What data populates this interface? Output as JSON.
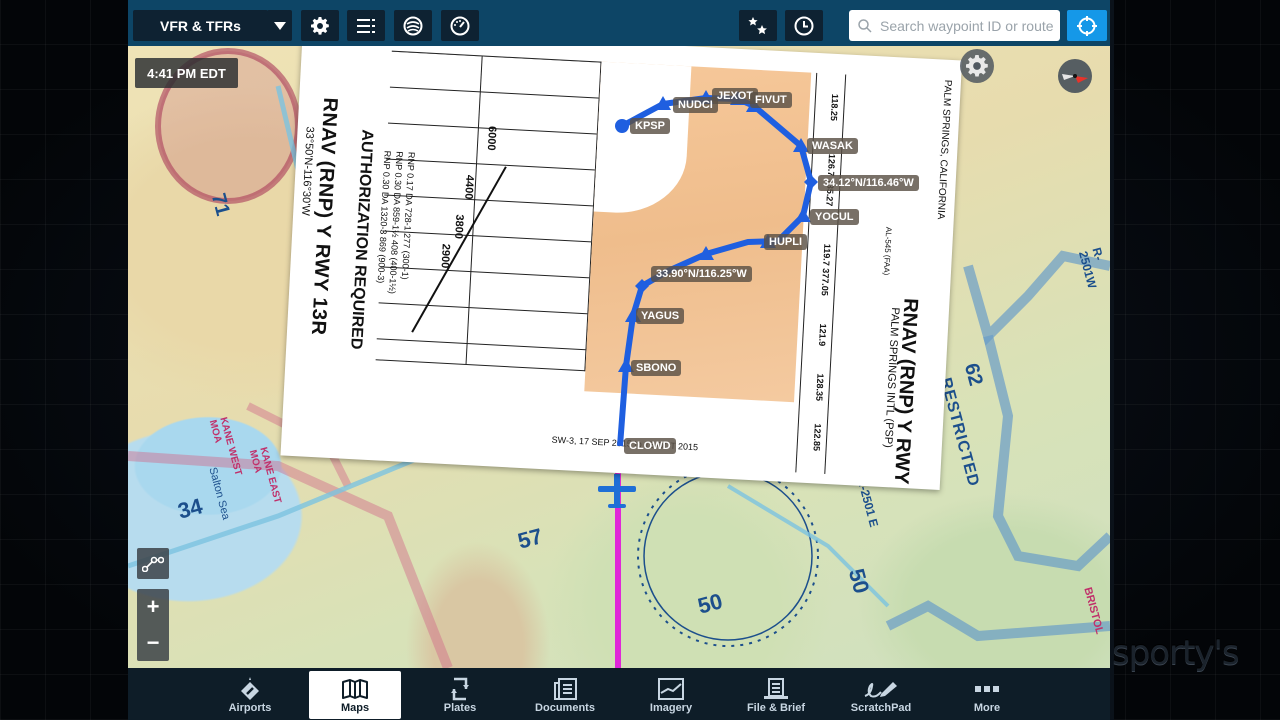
{
  "topbar": {
    "layer_selector": {
      "label": "VFR & TFRs",
      "icon": "caret-down-icon"
    },
    "buttons": [
      {
        "name": "settings",
        "icon": "gear-icon"
      },
      {
        "name": "layers-list",
        "icon": "list-icon"
      },
      {
        "name": "aircraft-profiles",
        "icon": "globe-icon"
      },
      {
        "name": "instruments",
        "icon": "gauge-icon"
      },
      {
        "name": "favorites",
        "icon": "stars-icon"
      },
      {
        "name": "recents",
        "icon": "clock-icon"
      }
    ],
    "search": {
      "placeholder": "Search waypoint ID or route",
      "value": ""
    },
    "locate_icon": "crosshair-icon"
  },
  "map": {
    "time": "4:41 PM EDT",
    "gear_icon": "gear-icon",
    "compass_icon": "compass-icon",
    "controls": {
      "route_icon": "route-edit-icon",
      "zoom_in": "+",
      "zoom_out": "−"
    },
    "chart_labels": {
      "restricted": "RESTRICTED",
      "r2501w": "R-2501W",
      "r2501e": "R-2501 E",
      "num_62": "62",
      "num_34": "34",
      "num_57": "57",
      "num_50a": "50",
      "num_50b": "50",
      "num_71": "71",
      "kane_west": "KANE WEST MOA",
      "kane_east": "KANE EAST MOA",
      "salton_sea": "Salton Sea",
      "bristol": "BRISTOL"
    },
    "route": {
      "color": "#1f5fe0",
      "active_leg_color": "#e026d8",
      "waypoints": [
        {
          "id": "KPSP"
        },
        {
          "id": "NUDCI"
        },
        {
          "id": "JEXOT"
        },
        {
          "id": "FIVUT"
        },
        {
          "id": "WASAK"
        },
        {
          "id": "34.12°N/116.46°W"
        },
        {
          "id": "YOCUL"
        },
        {
          "id": "HUPLI"
        },
        {
          "id": "33.90°N/116.25°W"
        },
        {
          "id": "YAGUS"
        },
        {
          "id": "SBONO"
        },
        {
          "id": "CLOWD"
        }
      ]
    },
    "approach_plate": {
      "title": "RNAV (RNP) Y RWY 13R",
      "airport": "PALM SPRINGS INTL (PSP)",
      "location": "PALM SPRINGS, CALIFORNIA",
      "authorization": "AUTHORIZATION REQUIRED",
      "coords": "33°50'N-116°30'W",
      "effective": "SW-3, 17 SEP 2015 to 15 OCT 2015",
      "al_number": "AL-545 (FAA)",
      "freqs": {
        "atis": "118.25",
        "socal_app": "126.7 135.27",
        "tower": "119.7 377.05",
        "gnd_con": "121.9",
        "clnc_del": "128.35",
        "unicom": "122.85"
      },
      "minimums": [
        "RNP 0.17 DA 728-1 277 (300-1)",
        "RNP 0.30 DA 859-1½ 408 (400-1½)",
        "RNP 0.30 DA 1320-3 869 (900-3)"
      ],
      "profile_alts": [
        "6000",
        "4400",
        "3800",
        "2900"
      ]
    }
  },
  "bottombar": {
    "tabs": [
      {
        "label": "Airports",
        "icon": "airport-icon",
        "active": false
      },
      {
        "label": "Maps",
        "icon": "map-icon",
        "active": true
      },
      {
        "label": "Plates",
        "icon": "plates-icon",
        "active": false
      },
      {
        "label": "Documents",
        "icon": "documents-icon",
        "active": false
      },
      {
        "label": "Imagery",
        "icon": "imagery-icon",
        "active": false
      },
      {
        "label": "File & Brief",
        "icon": "file-brief-icon",
        "active": false
      },
      {
        "label": "ScratchPad",
        "icon": "scratchpad-icon",
        "active": false
      },
      {
        "label": "More",
        "icon": "more-icon",
        "active": false
      }
    ]
  },
  "watermark": "sporty's"
}
